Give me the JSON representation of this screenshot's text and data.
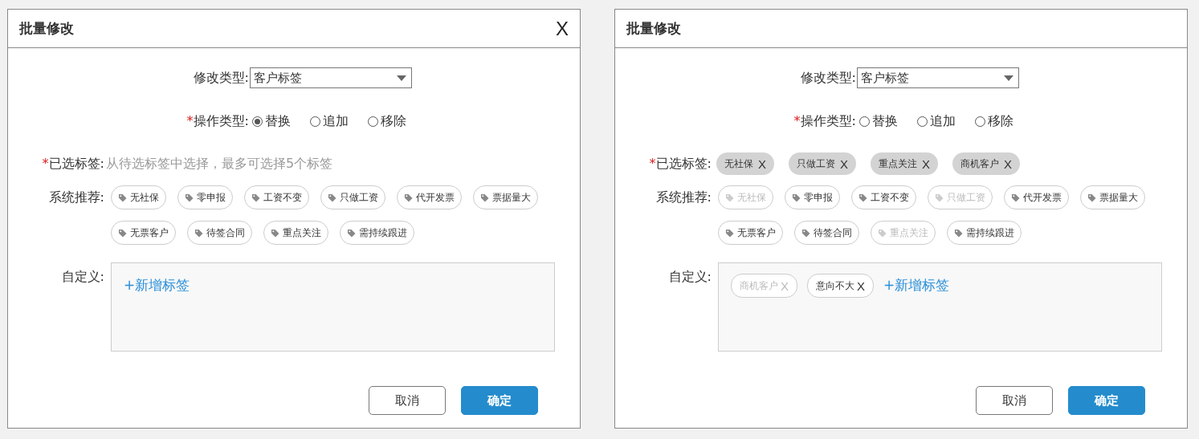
{
  "dialogs": [
    {
      "title": "批量修改",
      "close": "X",
      "type_field": {
        "label": "修改类型:",
        "value": "客户标签"
      },
      "operation": {
        "label": "操作类型:",
        "required": "*",
        "options": [
          {
            "label": "替换",
            "selected": true
          },
          {
            "label": "追加",
            "selected": false
          },
          {
            "label": "移除",
            "selected": false
          }
        ]
      },
      "selected_tags": {
        "label": "已选标签:",
        "required": "*",
        "placeholder": "从待选标签中选择，最多可选择5个标签"
      },
      "recommend": {
        "label": "系统推荐:",
        "rows": [
          [
            {
              "label": "无社保",
              "disabled": false
            },
            {
              "label": "零申报",
              "disabled": false
            },
            {
              "label": "工资不变",
              "disabled": false
            },
            {
              "label": "只做工资",
              "disabled": false
            },
            {
              "label": "代开发票",
              "disabled": false
            },
            {
              "label": "票据量大",
              "disabled": false
            }
          ],
          [
            {
              "label": "无票客户",
              "disabled": false
            },
            {
              "label": "待签合同",
              "disabled": false
            },
            {
              "label": "重点关注",
              "disabled": false
            },
            {
              "label": "需持续跟进",
              "disabled": false
            }
          ]
        ]
      },
      "custom": {
        "label": "自定义:",
        "add": "+新增标签"
      },
      "buttons": [
        {
          "label": "取消",
          "kind": "secondary"
        },
        {
          "label": "确定",
          "kind": "primary"
        }
      ]
    },
    {
      "title": "批量修改",
      "type_field": {
        "label": "修改类型:",
        "value": "客户标签"
      },
      "operation": {
        "label": "操作类型:",
        "required": "*",
        "options": [
          {
            "label": "替换",
            "selected": false
          },
          {
            "label": "追加",
            "selected": false
          },
          {
            "label": "移除",
            "selected": false
          }
        ]
      },
      "selected_tags": {
        "label": "已选标签:",
        "required": "*",
        "tags": [
          {
            "label": "无社保",
            "remove": "X"
          },
          {
            "label": "只做工资",
            "remove": "X"
          },
          {
            "label": "重点关注",
            "remove": "X"
          },
          {
            "label": "商机客户",
            "remove": "X"
          }
        ]
      },
      "recommend": {
        "label": "系统推荐:",
        "rows": [
          [
            {
              "label": "无社保",
              "disabled": true
            },
            {
              "label": "零申报",
              "disabled": false
            },
            {
              "label": "工资不变",
              "disabled": false
            },
            {
              "label": "只做工资",
              "disabled": true
            },
            {
              "label": "代开发票",
              "disabled": false
            },
            {
              "label": "票据量大",
              "disabled": false
            }
          ],
          [
            {
              "label": "无票客户",
              "disabled": false
            },
            {
              "label": "待签合同",
              "disabled": false
            },
            {
              "label": "重点关注",
              "disabled": true
            },
            {
              "label": "需持续跟进",
              "disabled": false
            }
          ]
        ]
      },
      "custom": {
        "label": "自定义:",
        "tags": [
          {
            "label": "商机客户",
            "remove": "X",
            "disabled": true
          },
          {
            "label": "意向不大",
            "remove": "X",
            "disabled": false
          }
        ],
        "add": "+新增标签"
      },
      "buttons": [
        {
          "label": "取消",
          "kind": "secondary"
        },
        {
          "label": "确定",
          "kind": "primary"
        }
      ]
    }
  ]
}
